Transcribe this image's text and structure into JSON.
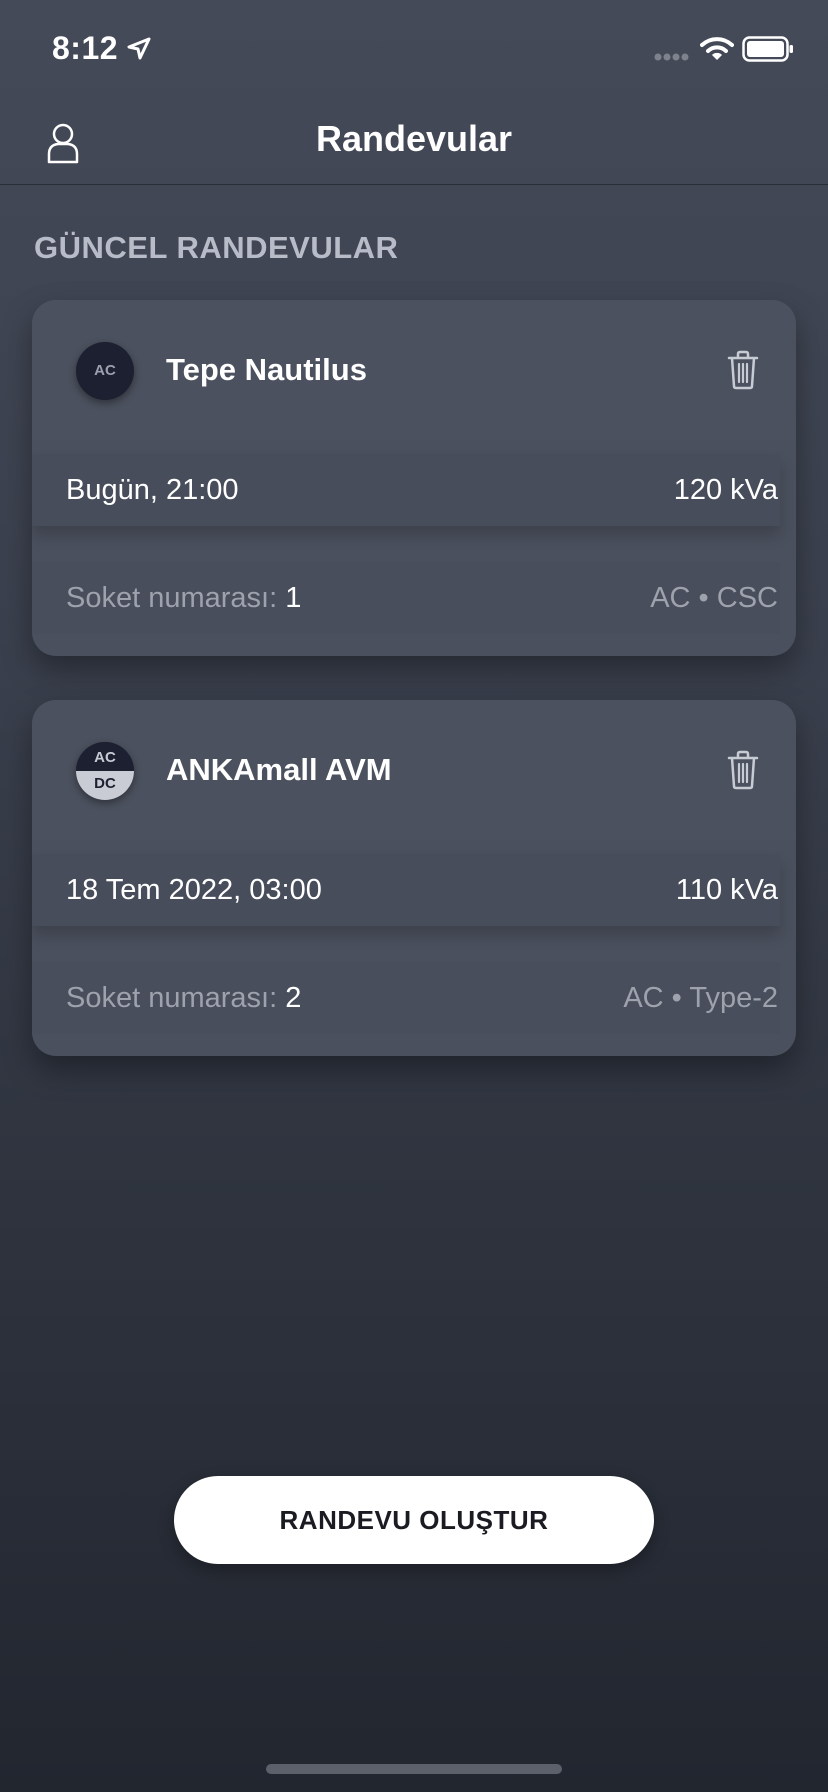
{
  "status_bar": {
    "time": "8:12",
    "icons": [
      "location-arrow-icon",
      "signal-icon",
      "wifi-icon",
      "battery-icon"
    ]
  },
  "nav": {
    "title": "Randevular",
    "left_icon": "profile-icon"
  },
  "section": {
    "title": "GÜNCEL RANDEVULAR"
  },
  "appointments": [
    {
      "badge_top": "AC",
      "badge_bottom": "",
      "station": "Tepe Nautilus",
      "datetime": "Bugün, 21:00",
      "power": "120 kVa",
      "socket_label": "Soket numarası:",
      "socket_number": "1",
      "connector": "AC • CSC"
    },
    {
      "badge_top": "AC",
      "badge_bottom": "DC",
      "station": "ANKAmall AVM",
      "datetime": "18 Tem 2022, 03:00",
      "power": "110 kVa",
      "socket_label": "Soket numarası:",
      "socket_number": "2",
      "connector": "AC • Type-2"
    }
  ],
  "actions": {
    "create_label": "RANDEVU OLUŞTUR"
  },
  "colors": {
    "background_top": "#444a58",
    "background_bottom": "#22262f",
    "card": "#4a505d",
    "badge_dark": "#1d2030",
    "button": "#ffffff"
  }
}
